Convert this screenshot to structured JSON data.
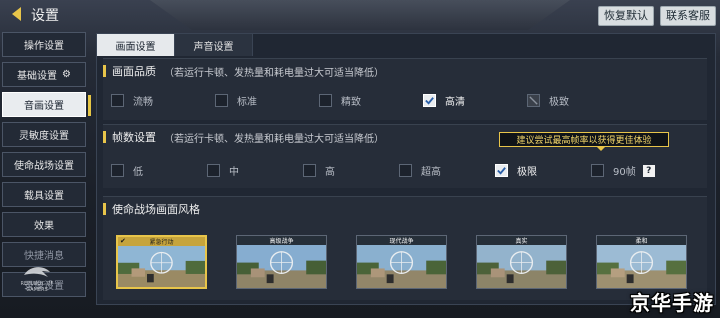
{
  "header": {
    "title": "设置",
    "restore_default": "恢复默认",
    "contact_support": "联系客服"
  },
  "sidebar": {
    "items": [
      {
        "label": "操作设置"
      },
      {
        "label": "基础设置",
        "icon": "gear-icon"
      },
      {
        "label": "音画设置",
        "active": true
      },
      {
        "label": "灵敏度设置"
      },
      {
        "label": "使命战场设置"
      },
      {
        "label": "载具设置"
      },
      {
        "label": "效果"
      },
      {
        "label": "快捷消息"
      },
      {
        "label": "录像设置"
      }
    ],
    "rog_logo": [
      "REPUBLIC OF",
      "GAMERS"
    ]
  },
  "tabs": [
    {
      "label": "画面设置",
      "active": true
    },
    {
      "label": "声音设置",
      "active": false
    }
  ],
  "quality": {
    "title": "画面品质",
    "hint": "（若运行卡顿、发热量和耗电量过大可适当降低）",
    "options": [
      {
        "label": "流畅",
        "state": "off"
      },
      {
        "label": "标准",
        "state": "off"
      },
      {
        "label": "精致",
        "state": "off"
      },
      {
        "label": "高清",
        "state": "on"
      },
      {
        "label": "极致",
        "state": "locked"
      }
    ]
  },
  "framerate": {
    "title": "帧数设置",
    "hint": "（若运行卡顿、发热量和耗电量过大可适当降低）",
    "tooltip": "建议尝试最高帧率以获得更佳体验",
    "help": "?",
    "options": [
      {
        "label": "低",
        "state": "off"
      },
      {
        "label": "中",
        "state": "off"
      },
      {
        "label": "高",
        "state": "off"
      },
      {
        "label": "超高",
        "state": "off"
      },
      {
        "label": "极限",
        "state": "on"
      },
      {
        "label": "90帧",
        "state": "off"
      }
    ]
  },
  "style": {
    "title": "使命战场画面风格",
    "cards": [
      {
        "label": "紧急行动",
        "selected": true
      },
      {
        "label": "高级战争",
        "selected": false
      },
      {
        "label": "现代战争",
        "selected": false
      },
      {
        "label": "真实",
        "selected": false
      },
      {
        "label": "柔和",
        "selected": false
      }
    ]
  },
  "watermark": "京华手游",
  "colors": {
    "accent": "#e8c54a",
    "panel": "#202733",
    "active_tab": "#e6e9ec"
  }
}
